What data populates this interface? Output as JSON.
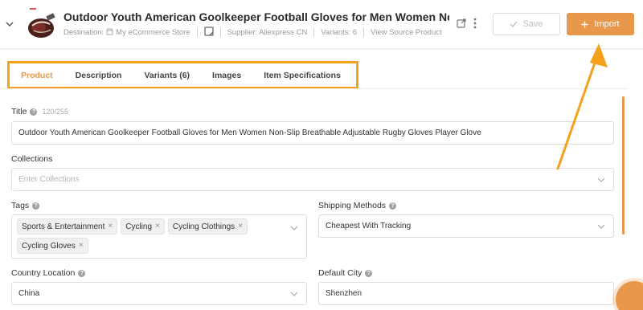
{
  "header": {
    "title": "Outdoor Youth American Goolkeeper Football Gloves for Men Women Non-Slip Breatha...",
    "destination_label": "Destination:",
    "destination_value": "My eCommerce Store",
    "supplier": "Supplier: Aliexpress CN",
    "variants": "Variants: 6",
    "view_source": "View Source Product",
    "save_label": "Save",
    "import_label": "Import"
  },
  "tabs": [
    {
      "label": "Product"
    },
    {
      "label": "Description"
    },
    {
      "label": "Variants (6)"
    },
    {
      "label": "Images"
    },
    {
      "label": "Item Specifications"
    }
  ],
  "form": {
    "title_label": "Title",
    "title_count": "120/255",
    "title_value": "Outdoor Youth American Goolkeeper Football Gloves for Men Women Non-Slip Breathable Adjustable Rugby Gloves Player Glove",
    "collections_label": "Collections",
    "collections_placeholder": "Enter Collections",
    "tags_label": "Tags",
    "tags": [
      "Sports & Entertainment",
      "Cycling",
      "Cycling Clothings",
      "Cycling Gloves"
    ],
    "shipping_label": "Shipping Methods",
    "shipping_value": "Cheapest With Tracking",
    "country_label": "Country Location",
    "country_value": "China",
    "city_label": "Default City",
    "city_value": "Shenzhen"
  },
  "colors": {
    "accent": "#e9974a",
    "highlight": "#f5a11c"
  }
}
